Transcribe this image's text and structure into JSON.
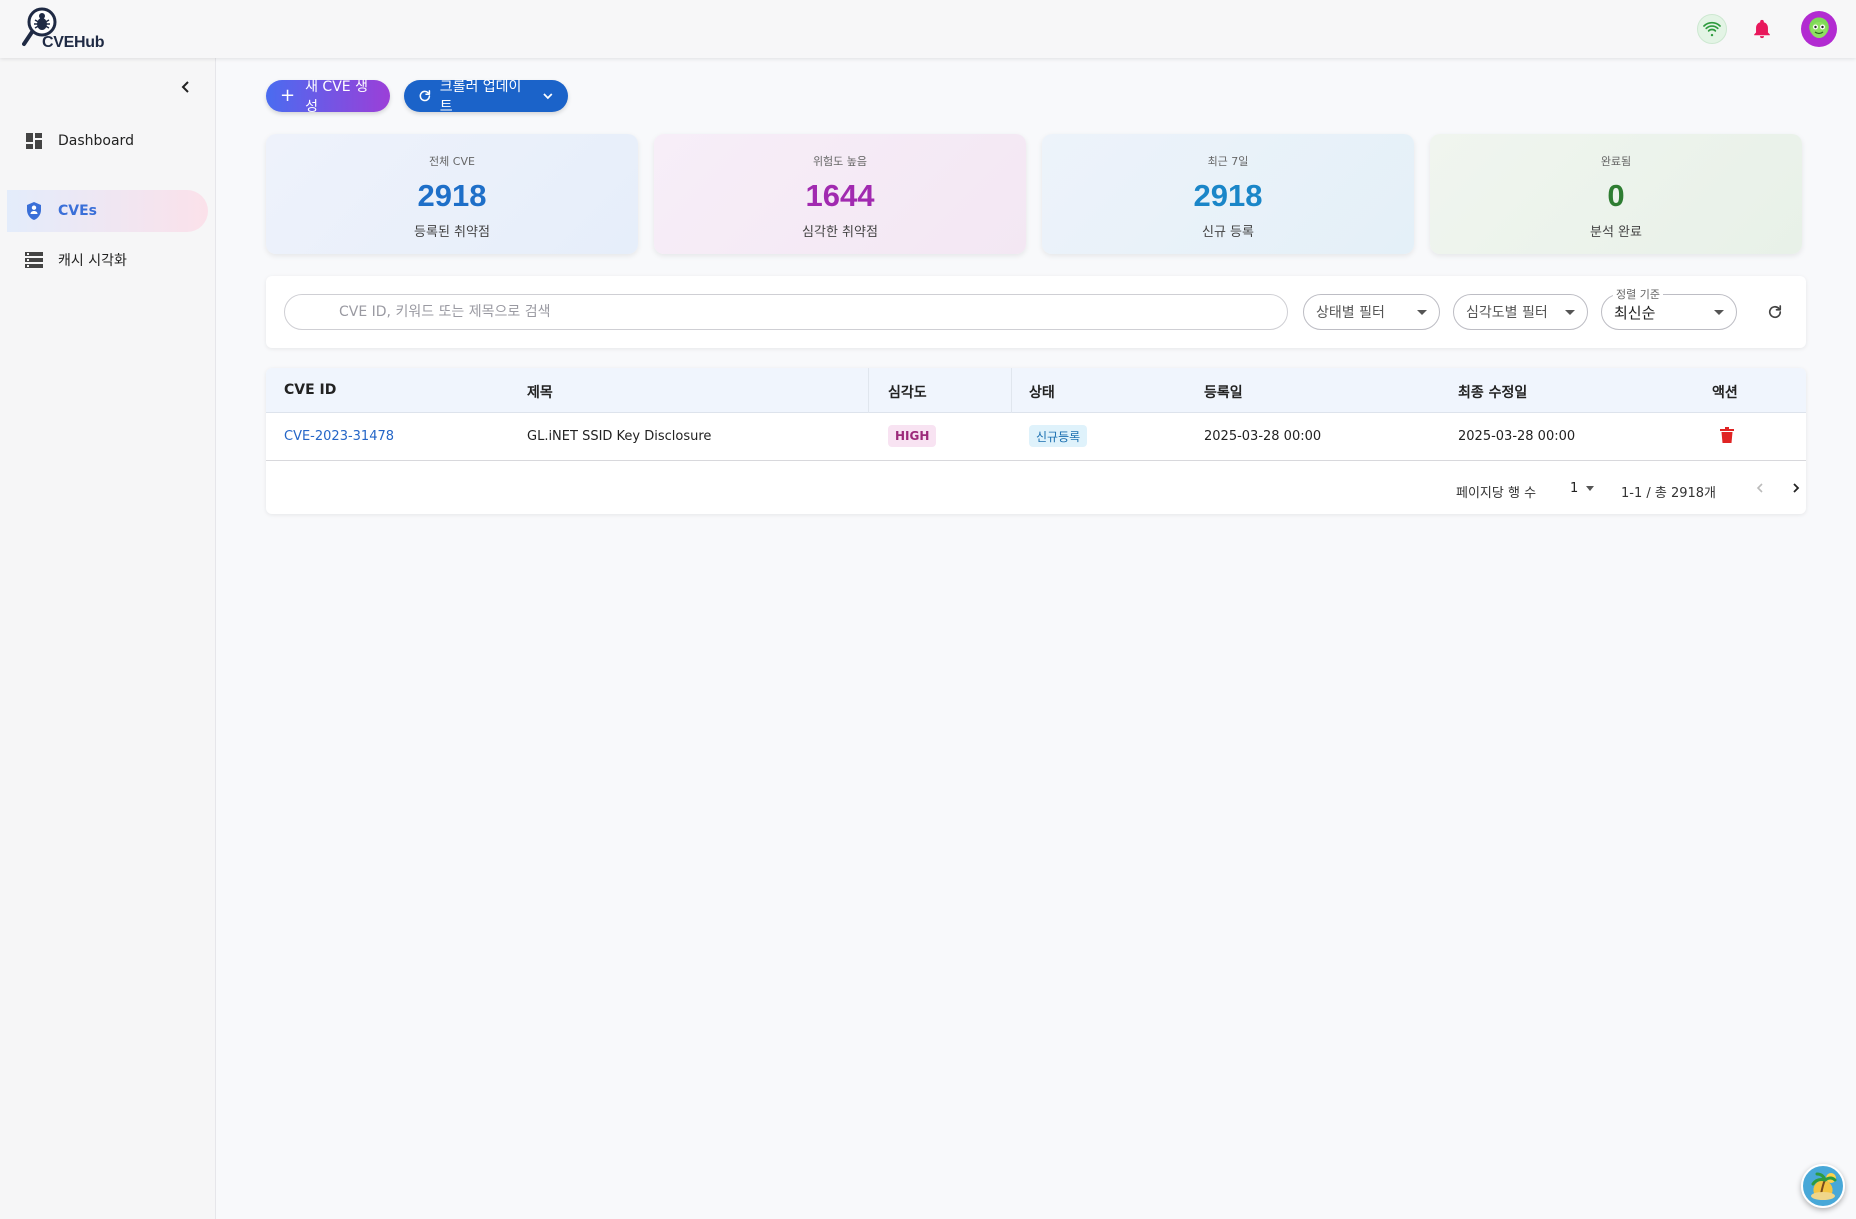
{
  "app": {
    "brand": "CVEHub"
  },
  "colors": {
    "primary": "#1b63c9",
    "accent_purple": "#9b3fd8",
    "high": "#9c2a7a",
    "link": "#2566c7"
  },
  "sidebar": {
    "items": [
      {
        "label": "Dashboard",
        "icon": "dashboard-icon"
      },
      {
        "label": "CVEs",
        "icon": "shield-icon",
        "active": true
      },
      {
        "label": "캐시 시각화",
        "icon": "storage-icon"
      }
    ]
  },
  "toolbar": {
    "new_label": "새 CVE 생성",
    "crawler_label": "크롤러 업데이트"
  },
  "stats": [
    {
      "label": "전체 CVE",
      "value": "2918",
      "sub": "등록된 취약점",
      "color": "#1e6fc8"
    },
    {
      "label": "위험도 높음",
      "value": "1644",
      "sub": "심각한 취약점",
      "color": "#a12ab0"
    },
    {
      "label": "최근 7일",
      "value": "2918",
      "sub": "신규 등록",
      "color": "#1a86c8"
    },
    {
      "label": "완료됨",
      "value": "0",
      "sub": "분석 완료",
      "color": "#2e7d32"
    }
  ],
  "filters": {
    "search_placeholder": "CVE ID, 키워드 또는 제목으로 검색",
    "status_label": "상태별 필터",
    "severity_label": "심각도별 필터",
    "sort_label": "정렬 기준",
    "sort_value": "최신순"
  },
  "table": {
    "headers": [
      "CVE ID",
      "제목",
      "심각도",
      "상태",
      "등록일",
      "최종 수정일",
      "액션"
    ],
    "rows": [
      {
        "id": "CVE-2023-31478",
        "title": "GL.iNET SSID Key Disclosure",
        "severity": "HIGH",
        "status": "신규등록",
        "created": "2025-03-28 00:00",
        "updated": "2025-03-28 00:00"
      }
    ]
  },
  "pagination": {
    "rows_label": "페이지당 행 수",
    "rows_value": "1",
    "range": "1-1 / 총 2918개"
  }
}
